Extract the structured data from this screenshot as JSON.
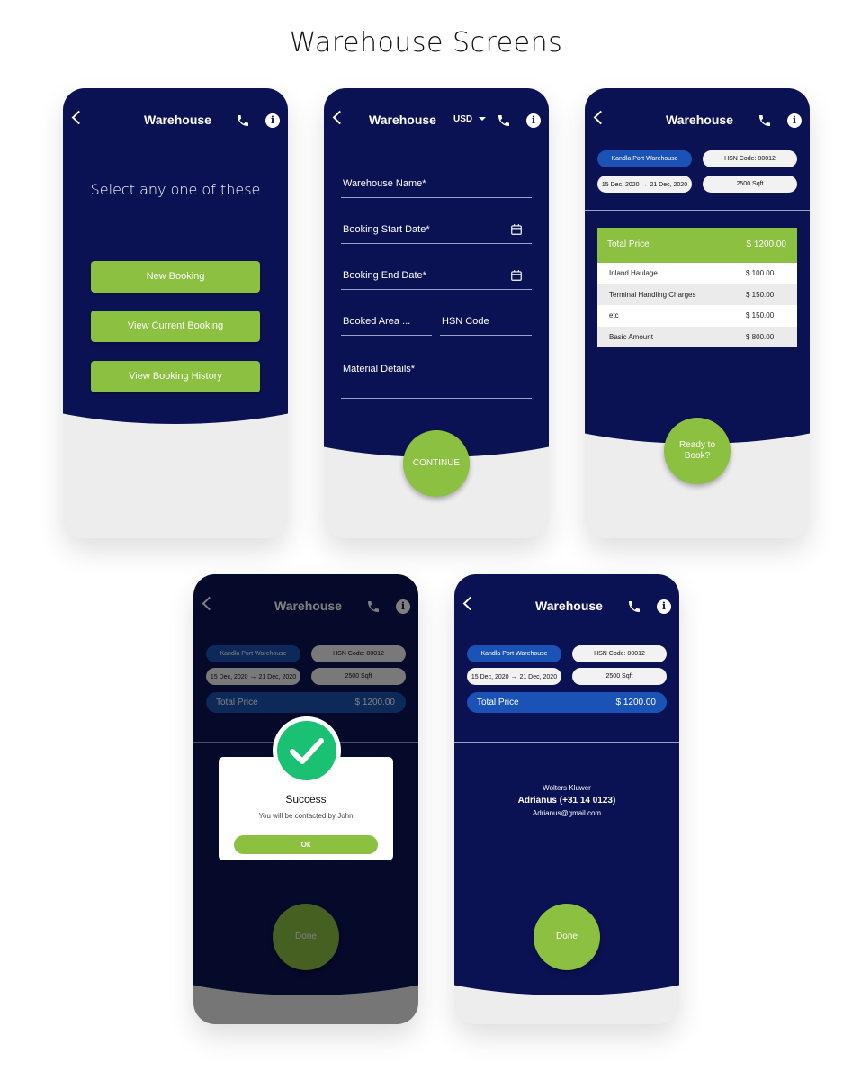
{
  "page": {
    "title": "Warehouse Screens"
  },
  "header": {
    "title": "Warehouse",
    "currency": "USD"
  },
  "screen1": {
    "prompt": "Select any one of these",
    "buttons": [
      "New Booking",
      "View Current Booking",
      "View Booking History"
    ]
  },
  "screen2": {
    "fields": {
      "warehouse_name": "Warehouse Name*",
      "start_date": "Booking Start Date*",
      "end_date": "Booking End Date*",
      "booked_area": "Booked Area ...",
      "hsn_code": "HSN Code",
      "material_details": "Material Details*"
    },
    "continue": "CONTINUE"
  },
  "summary": {
    "warehouse": "Kandla Port Warehouse",
    "hsn": "HSN Code: 80012",
    "date_from": "15 Dec, 2020",
    "date_to": "21 Dec, 2020",
    "area": "2500 Sqft",
    "total_label": "Total Price",
    "total_value": "$ 1200.00"
  },
  "screen3": {
    "items": [
      {
        "label": "Inland Haulage",
        "value": "$ 100.00"
      },
      {
        "label": "Terminal Handling Charges",
        "value": "$ 150.00"
      },
      {
        "label": "etc",
        "value": "$ 150.00"
      },
      {
        "label": "Basic Amount",
        "value": "$ 800.00"
      }
    ],
    "ready_line1": "Ready to",
    "ready_line2": "Book?"
  },
  "screen4": {
    "dialog_title": "Success",
    "dialog_message": "You will be contacted by John",
    "ok": "Ok",
    "done": "Done"
  },
  "screen5": {
    "company": "Wolters Kluwer",
    "contact": "Adrianus (+31 14 0123)",
    "email": "Adrianus@gmail.com",
    "done": "Done"
  },
  "colors": {
    "navy": "#0b1254",
    "green": "#8bc040",
    "blue": "#1b52b5",
    "success": "#1bc172"
  }
}
